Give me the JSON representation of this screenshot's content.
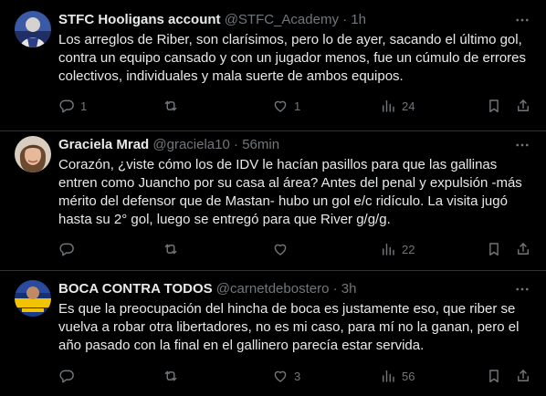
{
  "colors": {
    "background": "#000000",
    "text": "#e7e9ea",
    "secondary": "#71767b",
    "divider": "#2f3336"
  },
  "tweets": [
    {
      "name": "STFC Hooligans account",
      "handle": "@STFC_Academy",
      "dot": "·",
      "time": "1h",
      "text": "Los arreglos de Riber, son clarísimos, pero lo de ayer, sacando el último gol, contra un equipo cansado y con un jugador menos, fue un cúmulo de errores colectivos, individuales y mala suerte de ambos equipos.",
      "replies": "1",
      "retweets": "",
      "likes": "1",
      "views": "24"
    },
    {
      "name": "Graciela Mrad",
      "handle": "@graciela10",
      "dot": "·",
      "time": "56min",
      "text": "Corazón, ¿viste cómo los de IDV le hacían pasillos para que las gallinas entren como Juancho por su casa al área? Antes del penal y expulsión -más mérito del defensor que de Mastan- hubo un gol e/c ridículo. La visita jugó hasta su 2° gol, luego se entregó para que River g/g/g.",
      "replies": "",
      "retweets": "",
      "likes": "",
      "views": "22"
    },
    {
      "name": "BOCA CONTRA TODOS",
      "handle": "@carnetdebostero",
      "dot": "·",
      "time": "3h",
      "text": "Es que la preocupación del hincha de boca es justamente eso, que riber se vuelva a robar otra libertadores, no es mi caso, para mí no la ganan, pero el año pasado con la final en el gallinero parecía estar servida.",
      "replies": "",
      "retweets": "",
      "likes": "3",
      "views": "56"
    }
  ]
}
